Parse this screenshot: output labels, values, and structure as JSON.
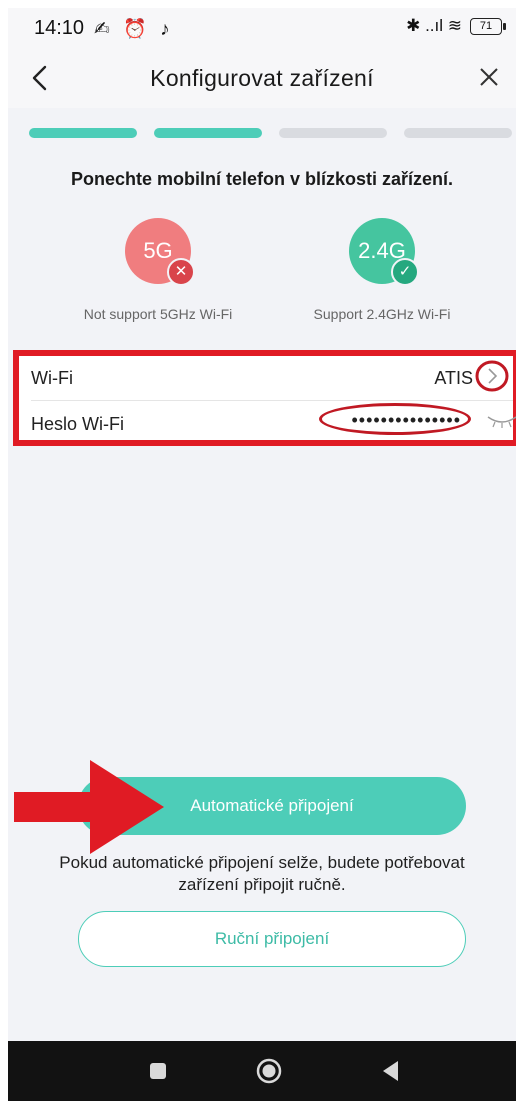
{
  "status_bar": {
    "time": "14:10",
    "left_icons": "✍ ⏰ ♪",
    "right_icons": "✱ ..ıl ≋",
    "battery": "71"
  },
  "header": {
    "title": "Konfigurovat zařízení"
  },
  "progress": {
    "total_steps": 4,
    "completed_steps": 2,
    "active_color": "#4dcdb8",
    "inactive_color": "#d9dbe0"
  },
  "instruction": "Ponechte mobilní telefon v blízkosti zařízení.",
  "bands": [
    {
      "label": "5G",
      "caption": "Not support 5GHz Wi-Fi",
      "color": "#f07d7f",
      "mark": "✕",
      "mark_color": "#d9444b",
      "icon": "close-icon"
    },
    {
      "label": "2.4G",
      "caption": "Support 2.4GHz Wi-Fi",
      "color": "#45c59f",
      "mark": "✓",
      "mark_color": "#25a87f",
      "icon": "check-icon"
    }
  ],
  "wifi": {
    "network_label": "Wi-Fi",
    "network_value": "ATIS",
    "password_label": "Heslo Wi-Fi",
    "password_value": "•••••••••••••••"
  },
  "actions": {
    "auto_connect": "Automatické připojení",
    "note": "Pokud automatické připojení selže, budete potřebovat zařízení připojit ručně.",
    "manual_connect": "Ruční připojení"
  },
  "colors": {
    "accent": "#4dcdb8",
    "annotation_red": "#e01b24"
  }
}
